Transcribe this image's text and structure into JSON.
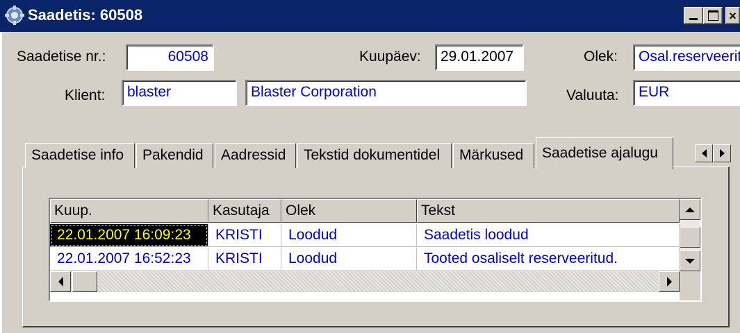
{
  "window": {
    "title": "Saadetis: 60508",
    "icon": "app-gear-icon",
    "controls": [
      "minimize-icon",
      "maximize-icon",
      "close-icon"
    ]
  },
  "header": {
    "shipment_nr_label": "Saadetise nr.:",
    "shipment_nr_value": "60508",
    "date_label": "Kuupäev:",
    "date_value": "29.01.2007",
    "status_label": "Olek:",
    "status_value": "Osal.reserveerit",
    "client_label": "Klient:",
    "client_code": "blaster",
    "client_name": "Blaster Corporation",
    "currency_label": "Valuuta:",
    "currency_value": "EUR"
  },
  "tabs": [
    {
      "label": "Saadetise info",
      "active": false
    },
    {
      "label": "Pakendid",
      "active": false
    },
    {
      "label": "Aadressid",
      "active": false
    },
    {
      "label": "Tekstid dokumentidel",
      "active": false
    },
    {
      "label": "Märkused",
      "active": false
    },
    {
      "label": "Saadetise ajalugu",
      "active": true
    }
  ],
  "grid": {
    "columns": [
      "Kuup.",
      "Kasutaja",
      "Olek",
      "Tekst"
    ],
    "rows": [
      [
        "22.01.2007 16:09:23",
        "KRISTI",
        "Loodud",
        "Saadetis loodud"
      ],
      [
        "22.01.2007 16:52:23",
        "KRISTI",
        "Loodud",
        "Tooted osaliselt reserveeritud."
      ]
    ],
    "selected_row": 0
  },
  "colors": {
    "titlebar": "#0a246a",
    "face": "#d4d0c8",
    "value_text": "#0000c8",
    "selected_bg": "#000000",
    "selected_text": "#ffff00"
  }
}
